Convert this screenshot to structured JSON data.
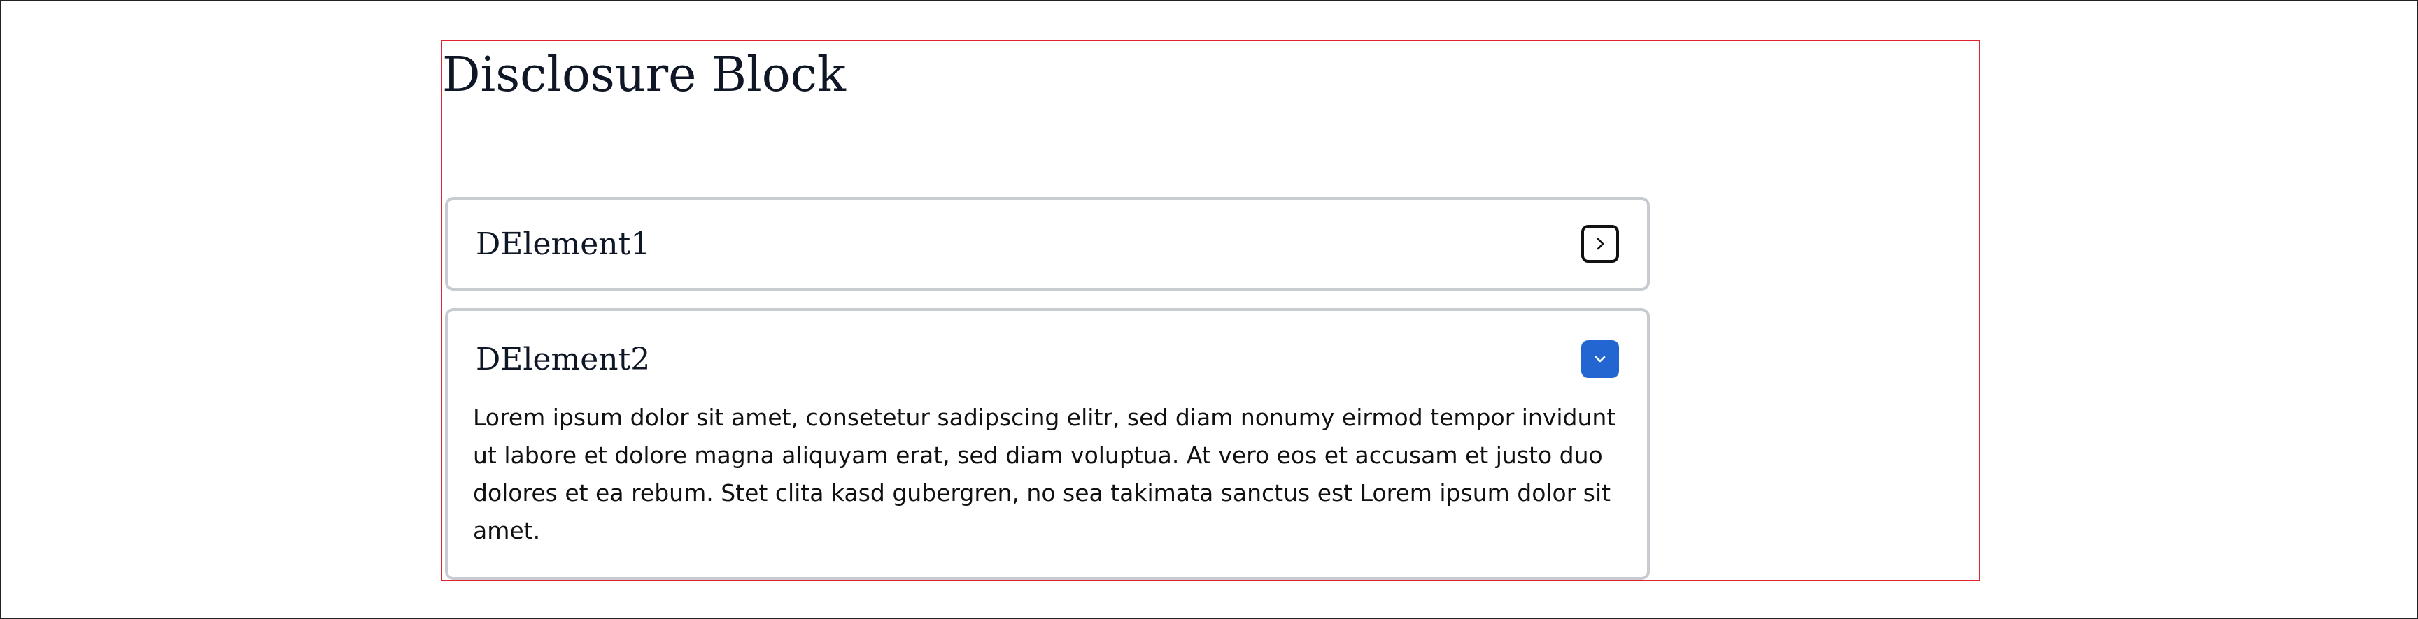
{
  "page": {
    "title": "Disclosure Block"
  },
  "disclosures": [
    {
      "label": "DElement1",
      "expanded": false,
      "toggle_icon": "chevron-right-icon",
      "content": ""
    },
    {
      "label": "DElement2",
      "expanded": true,
      "toggle_icon": "chevron-down-icon",
      "content": "Lorem ipsum dolor sit amet, consetetur sadipscing elitr, sed diam nonumy eirmod tempor invidunt ut labore et dolore magna aliquyam erat, sed diam voluptua. At vero eos et accusam et justo duo dolores et ea rebum. Stet clita kasd gubergren, no sea takimata sanctus est Lorem ipsum dolor sit amet."
    }
  ],
  "colors": {
    "frame_outline": "#e0242f",
    "disclosure_border": "#c8cbd2",
    "toggle_active": "#2366d1",
    "heading_text": "#0f1726"
  }
}
